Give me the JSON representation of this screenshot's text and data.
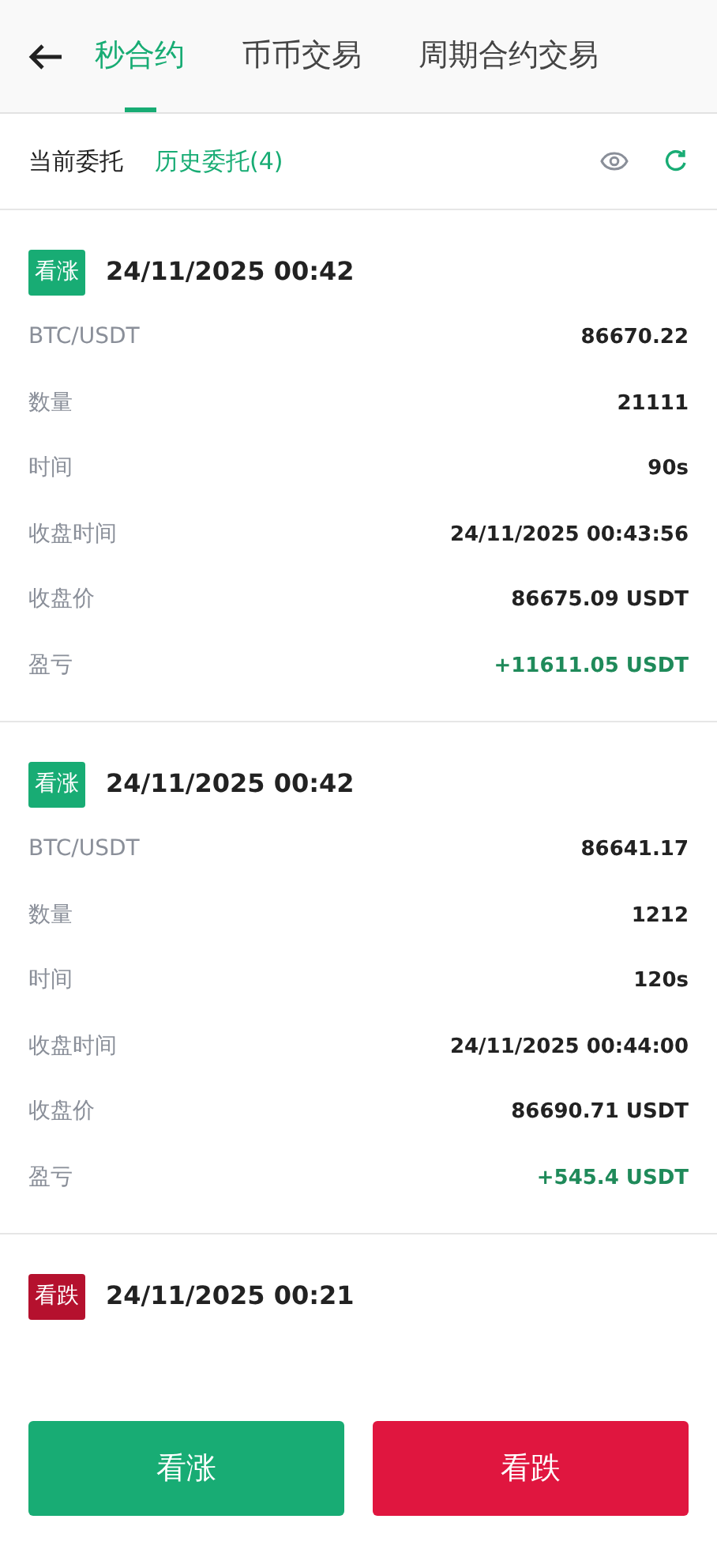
{
  "tabs": [
    {
      "label": "秒合约",
      "selected": true
    },
    {
      "label": "币币交易",
      "selected": false
    },
    {
      "label": "周期合约交易",
      "selected": false
    }
  ],
  "filters": [
    {
      "label": "当前委托",
      "selected": false
    },
    {
      "label": "历史委托(4)",
      "selected": true
    }
  ],
  "orders": [
    {
      "direction": {
        "kind": "up",
        "label": "看涨"
      },
      "time": "24/11/2025 00:42",
      "rows": [
        {
          "kind": "plain",
          "label": "BTC/USDT",
          "value": "86670.22"
        },
        {
          "kind": "plain",
          "label": "数量",
          "value": "21111"
        },
        {
          "kind": "plain",
          "label": "时间",
          "value": "90s"
        },
        {
          "kind": "plain",
          "label": "收盘时间",
          "value": "24/11/2025 00:43:56"
        },
        {
          "kind": "plain",
          "label": "收盘价",
          "value": "86675.09 USDT"
        },
        {
          "kind": "pnl",
          "label": "盈亏",
          "value": "+11611.05 USDT"
        }
      ]
    },
    {
      "direction": {
        "kind": "up",
        "label": "看涨"
      },
      "time": "24/11/2025 00:42",
      "rows": [
        {
          "kind": "plain",
          "label": "BTC/USDT",
          "value": "86641.17"
        },
        {
          "kind": "plain",
          "label": "数量",
          "value": "1212"
        },
        {
          "kind": "plain",
          "label": "时间",
          "value": "120s"
        },
        {
          "kind": "plain",
          "label": "收盘时间",
          "value": "24/11/2025 00:44:00"
        },
        {
          "kind": "plain",
          "label": "收盘价",
          "value": "86690.71 USDT"
        },
        {
          "kind": "pnl",
          "label": "盈亏",
          "value": "+545.4 USDT"
        }
      ]
    },
    {
      "direction": {
        "kind": "down",
        "label": "看跌"
      },
      "time": "24/11/2025 00:21"
    }
  ],
  "actions": [
    {
      "kind": "up",
      "label": "看涨"
    },
    {
      "kind": "down",
      "label": "看跌"
    }
  ]
}
